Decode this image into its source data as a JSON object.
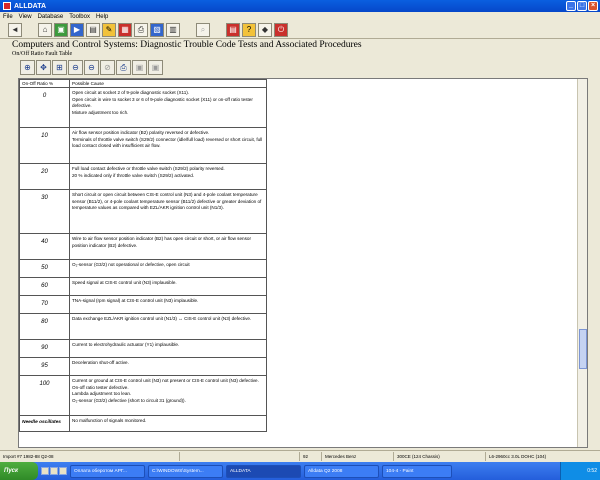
{
  "window": {
    "title": "ALLDATA",
    "buttons": [
      "_",
      "□",
      "×"
    ]
  },
  "menu": [
    "File",
    "View",
    "Database",
    "Toolbox",
    "Help"
  ],
  "toolbar": [
    "◄",
    "⌂",
    "▣",
    "▶",
    "▤",
    "✎",
    "▦",
    "⎙",
    "▧",
    "▥",
    "⌕",
    "▤",
    "?",
    "◆",
    "⏻"
  ],
  "page": {
    "title": "Computers and Control Systems:  Diagnostic Trouble Code Tests and Associated Procedures",
    "subtitle": "On/Off Ratio Fault Table"
  },
  "doc_toolbar": [
    "⊕",
    "✥",
    "⊞",
    "⊖",
    "⊖",
    "⊘",
    "⎙",
    "▣",
    "▣"
  ],
  "table": {
    "headers": [
      "On-Off Ratio %",
      "Possible Cause"
    ],
    "rows": [
      {
        "ratio": "0",
        "cause": [
          "Open circuit at socket 2 of 9-pole diagnostic socket (X11).",
          "Open circuit in wire to socket 3 or 6 of 9-pole diagnostic socket (X11) or on-off ratio tester defective.",
          "Mixture adjustment too rich."
        ]
      },
      {
        "ratio": "10",
        "cause": [
          "Air flow sensor position indicator (B2) polarity reversed or defective.",
          "Terminals of throttle valve switch (S29/2) connector (idle/full load) reversed or short circuit, full load contact closed with insufficient air flow."
        ]
      },
      {
        "ratio": "20",
        "cause": [
          "Full load contact defective or throttle valve switch (S29/2) polarity reversed.",
          "20 % indicated only if throttle valve switch (S29/2) activated."
        ]
      },
      {
        "ratio": "30",
        "cause": [
          "Short circuit or open circuit between CIS-E control unit (N3) and 4-pole coolant temperature sensor (B11/2), or 4-pole coolant temperature sensor (B11/2) defective or greater deviation of temperature values as compared with EZL/AKR ignition control unit (N1/3)."
        ]
      },
      {
        "ratio": "40",
        "cause": [
          "Wire to air flow sensor position indicator (B2) has open circuit or short, or air flow sensor position indicator (B2) defective."
        ]
      },
      {
        "ratio": "50",
        "cause": [
          "O₂-sensor (G3/2) not operational or defective, open circuit"
        ]
      },
      {
        "ratio": "60",
        "cause": [
          "Speed signal at CIS-E control unit (N3) implausible."
        ]
      },
      {
        "ratio": "70",
        "cause": [
          "TNA-signal (rpm signal) at CIS-E control unit (N3) implausible."
        ]
      },
      {
        "ratio": "80",
        "cause": [
          "Data exchange EZL/AKR ignition control unit (N1/3) ↔ CIS-E control unit (N3) defective."
        ]
      },
      {
        "ratio": "90",
        "cause": [
          "Current to electrohydraulic actuator (Y1) implausible."
        ]
      },
      {
        "ratio": "95",
        "cause": [
          "Deceleration shut-off active."
        ]
      },
      {
        "ratio": "100",
        "cause": [
          "Current or ground at CIS-E control unit (N3) not present or CIS-E control unit (N3) defective.",
          "On-off ratio tester defective.",
          "Lambda adjustment too lean.",
          "O₂-sensor (G3/2) defective (short to circuit 31 (ground))."
        ]
      },
      {
        "ratio": "Needle oscillates",
        "cause": [
          "No malfunction of signals monitored."
        ]
      }
    ]
  },
  "status": [
    "Import #7 1982-88 Q2-08",
    "",
    "92",
    "Mercedes Benz",
    "300CE (124 Chassis)",
    "L6-2960cc 3.0L DOHC (104)"
  ],
  "taskbar": {
    "start": "Пуск",
    "items": [
      "Оплата оберотом АРГ...",
      "C:\\WINDOWS\\System...",
      "ALLDATA",
      "Alldata Q2 2008",
      "104-4 - Paint"
    ],
    "clock": "0:52"
  }
}
